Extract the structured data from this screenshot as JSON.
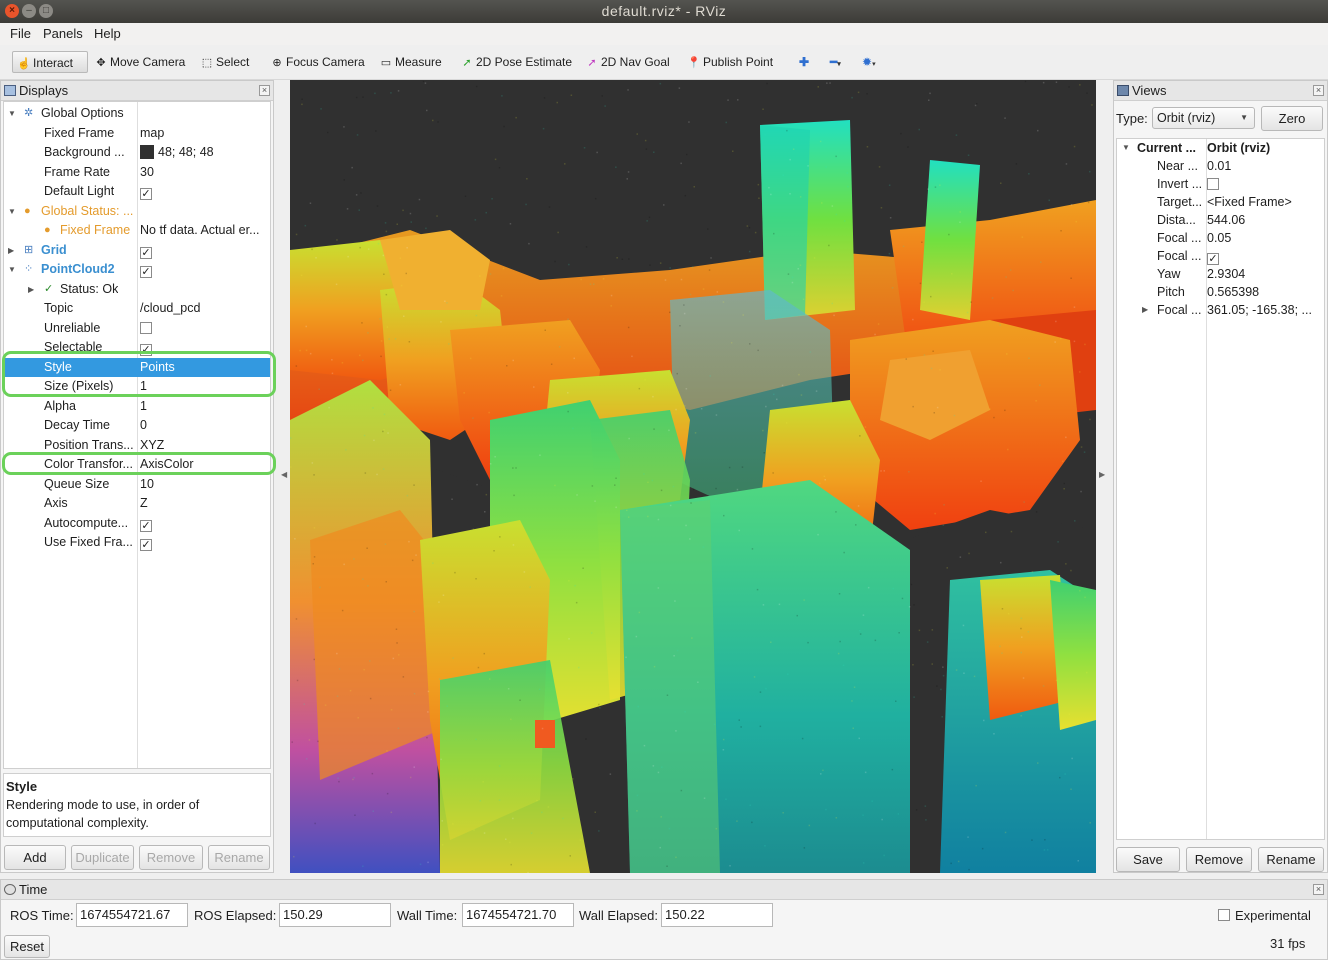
{
  "window": {
    "title": "default.rviz* - RViz"
  },
  "menu": {
    "file": "File",
    "panels": "Panels",
    "help": "Help"
  },
  "toolbar": {
    "interact": "Interact",
    "move_camera": "Move Camera",
    "select": "Select",
    "focus_camera": "Focus Camera",
    "measure": "Measure",
    "pose_estimate": "2D Pose Estimate",
    "nav_goal": "2D Nav Goal",
    "publish_point": "Publish Point"
  },
  "displays": {
    "title": "Displays",
    "rows": [
      {
        "label": "Global Options",
        "value": ""
      },
      {
        "label": "Fixed Frame",
        "value": "map"
      },
      {
        "label": "Background ...",
        "value": "48; 48; 48"
      },
      {
        "label": "Frame Rate",
        "value": "30"
      },
      {
        "label": "Default Light",
        "value": ""
      },
      {
        "label": "Global Status: ...",
        "value": ""
      },
      {
        "label": "Fixed Frame",
        "value": "No tf data.  Actual er..."
      },
      {
        "label": "Grid",
        "value": ""
      },
      {
        "label": "PointCloud2",
        "value": ""
      },
      {
        "label": "Status: Ok",
        "value": ""
      },
      {
        "label": "Topic",
        "value": "/cloud_pcd"
      },
      {
        "label": "Unreliable",
        "value": ""
      },
      {
        "label": "Selectable",
        "value": ""
      },
      {
        "label": "Style",
        "value": "Points"
      },
      {
        "label": "Size (Pixels)",
        "value": "1"
      },
      {
        "label": "Alpha",
        "value": "1"
      },
      {
        "label": "Decay Time",
        "value": "0"
      },
      {
        "label": "Position Trans...",
        "value": "XYZ"
      },
      {
        "label": "Color Transfor...",
        "value": "AxisColor"
      },
      {
        "label": "Queue Size",
        "value": "10"
      },
      {
        "label": "Axis",
        "value": "Z"
      },
      {
        "label": "Autocompute...",
        "value": ""
      },
      {
        "label": "Use Fixed Fra...",
        "value": ""
      }
    ],
    "desc_title": "Style",
    "desc_text": "Rendering mode to use, in order of computational complexity.",
    "buttons": {
      "add": "Add",
      "duplicate": "Duplicate",
      "remove": "Remove",
      "rename": "Rename"
    }
  },
  "views": {
    "title": "Views",
    "type_label": "Type:",
    "type_value": "Orbit (rviz)",
    "zero": "Zero",
    "rows": [
      {
        "label": "Current ...",
        "value": "Orbit (rviz)"
      },
      {
        "label": "Near ...",
        "value": "0.01"
      },
      {
        "label": "Invert ...",
        "value": ""
      },
      {
        "label": "Target...",
        "value": "<Fixed Frame>"
      },
      {
        "label": "Dista...",
        "value": "544.06"
      },
      {
        "label": "Focal ...",
        "value": "0.05"
      },
      {
        "label": "Focal ...",
        "value": ""
      },
      {
        "label": "Yaw",
        "value": "2.9304"
      },
      {
        "label": "Pitch",
        "value": "0.565398"
      },
      {
        "label": "Focal ...",
        "value": "361.05; -165.38; ..."
      }
    ],
    "buttons": {
      "save": "Save",
      "remove": "Remove",
      "rename": "Rename"
    }
  },
  "time": {
    "title": "Time",
    "ros_time_label": "ROS Time:",
    "ros_time": "1674554721.67",
    "ros_elapsed_label": "ROS Elapsed:",
    "ros_elapsed": "150.29",
    "wall_time_label": "Wall Time:",
    "wall_time": "1674554721.70",
    "wall_elapsed_label": "Wall Elapsed:",
    "wall_elapsed": "150.22",
    "experimental": "Experimental",
    "reset": "Reset",
    "fps": "31 fps"
  },
  "colors": {
    "background": "#303030",
    "selection": "#3399e0",
    "highlight": "#6bd15a",
    "accent": "#3a8fd0"
  },
  "icons": [
    "close-icon",
    "minimize-icon",
    "maximize-icon",
    "interact-icon",
    "move-camera-icon",
    "select-icon",
    "focus-camera-icon",
    "measure-icon",
    "pose-estimate-icon",
    "nav-goal-icon",
    "publish-point-icon",
    "zoom-in-icon",
    "zoom-out-icon",
    "camera-type-icon"
  ]
}
